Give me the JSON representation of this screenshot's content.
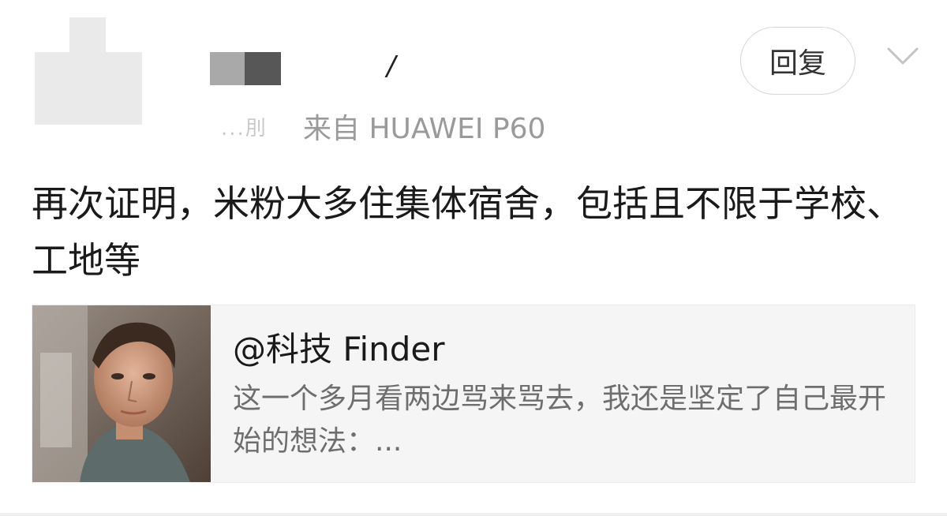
{
  "post": {
    "username_suffix": "/",
    "time_text": "...刖",
    "source": "来自 HUAWEI P60",
    "reply_label": "回复",
    "content": "再次证明，米粉大多住集体宿舍，包括且不限于学校、工地等"
  },
  "quoted_card": {
    "title": "@科技 Finder",
    "excerpt": "这一个多月看两边骂来骂去，我还是坚定了自己最开始的想法：..."
  },
  "colors": {
    "card_bg": "#f5f5f5",
    "meta_text": "#9a9a9a",
    "excerpt_text": "#6e6e6e"
  },
  "icons": {
    "more": "chevron-down-icon",
    "avatar": "pixelated-avatar"
  }
}
